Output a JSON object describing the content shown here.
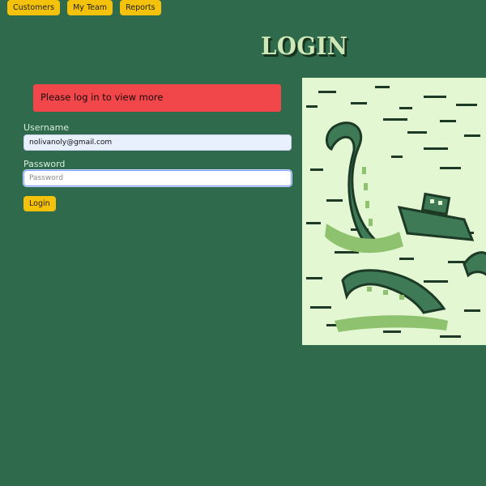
{
  "nav": {
    "items": [
      {
        "label": "Customers"
      },
      {
        "label": "My Team"
      },
      {
        "label": "Reports"
      }
    ]
  },
  "page": {
    "title": "LOGIN"
  },
  "alert": {
    "message": "Please log in to view more"
  },
  "form": {
    "username_label": "Username",
    "username_value": "nolivanoly@gmail.com",
    "password_label": "Password",
    "password_placeholder": "Password",
    "submit_label": "Login"
  },
  "colors": {
    "background": "#2f6a4d",
    "accent": "#f5c20b",
    "alert": "#f1474a",
    "art_background": "#e3f7d2"
  },
  "illustration": {
    "subject": "pixel-art kraken tentacles sinking a boat"
  }
}
